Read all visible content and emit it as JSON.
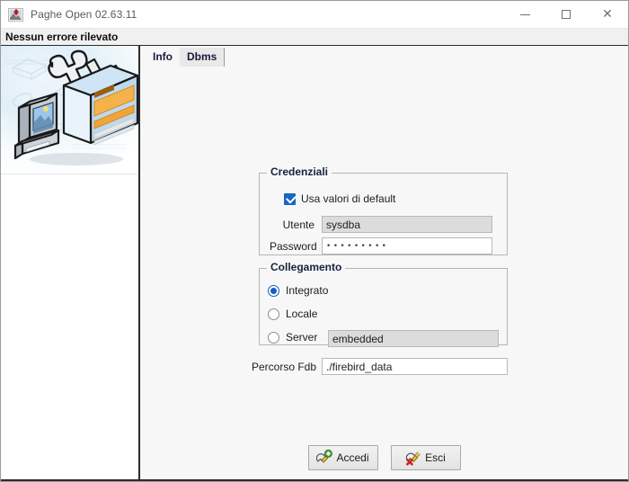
{
  "window": {
    "title": "Paghe Open 02.63.11",
    "app_icon": "app-icon",
    "controls": {
      "minimize": "minimize-icon",
      "maximize": "maximize-icon",
      "close": "close-icon"
    }
  },
  "status": {
    "message": "Nessun errore rilevato"
  },
  "sidebar": {
    "illustration": "software-toolbox-illustration"
  },
  "tabs": [
    {
      "label": "Info",
      "active": false
    },
    {
      "label": "Dbms",
      "active": true
    }
  ],
  "credentials": {
    "legend": "Credenziali",
    "use_defaults": {
      "label": "Usa valori di default",
      "checked": true
    },
    "user": {
      "label": "Utente",
      "value": "sysdba",
      "enabled": false
    },
    "password": {
      "label": "Password",
      "value": "•••••••••",
      "enabled": true
    }
  },
  "connection": {
    "legend": "Collegamento",
    "options": [
      {
        "label": "Integrato",
        "selected": true
      },
      {
        "label": "Locale",
        "selected": false
      },
      {
        "label": "Server",
        "selected": false
      }
    ],
    "server": {
      "value": "embedded",
      "enabled": false
    }
  },
  "fdb_path": {
    "label": "Percorso Fdb",
    "value": "./firebird_data",
    "enabled": true
  },
  "actions": {
    "login": {
      "label": "Accedi",
      "icon": "plug-connect-icon"
    },
    "exit": {
      "label": "Esci",
      "icon": "plug-disconnect-icon"
    }
  },
  "colors": {
    "accent_blue": "#1560bd",
    "content_bg": "#f7f7f7",
    "status_bg": "#f0f0f0",
    "disabled_field": "#dcdcdc"
  }
}
